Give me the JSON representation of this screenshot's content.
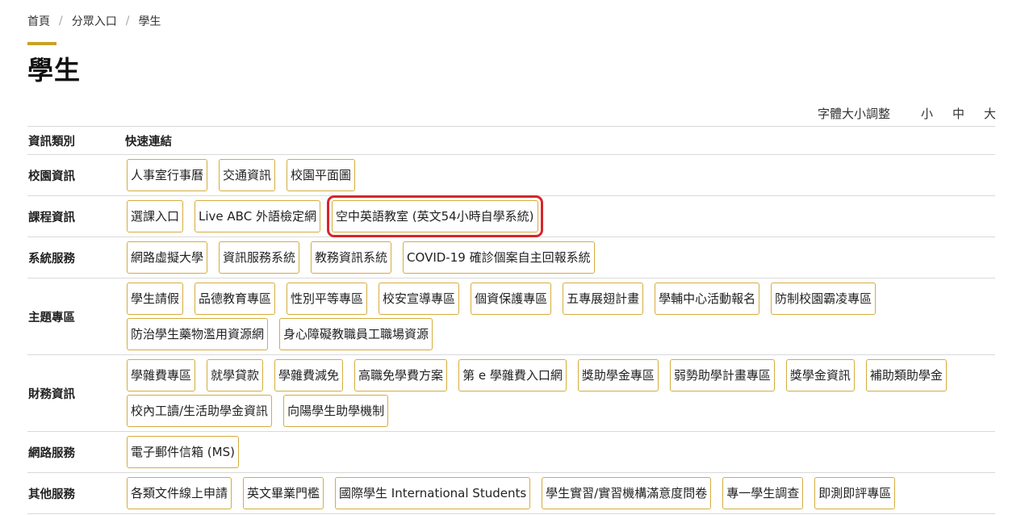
{
  "breadcrumb": [
    "首頁",
    "分眾入口",
    "學生"
  ],
  "page_title": "學生",
  "font_size": {
    "label": "字體大小調整",
    "options": [
      "小",
      "中",
      "大"
    ]
  },
  "table": {
    "header": {
      "category": "資訊類別",
      "links": "快速連結"
    },
    "rows": [
      {
        "category": "校園資訊",
        "links": [
          "人事室行事曆",
          "交通資訊",
          "校園平面圖"
        ]
      },
      {
        "category": "課程資訊",
        "links": [
          "選課入口",
          "Live ABC 外語檢定網",
          "空中英語教室 (英文54小時自學系統)"
        ]
      },
      {
        "category": "系統服務",
        "links": [
          "網路虛擬大學",
          "資訊服務系統",
          "教務資訊系統",
          "COVID-19 確診個案自主回報系統"
        ]
      },
      {
        "category": "主題專區",
        "links": [
          "學生請假",
          "品德教育專區",
          "性別平等專區",
          "校安宣導專區",
          "個資保護專區",
          "五專展翅計畫",
          "學輔中心活動報名",
          "防制校園霸凌專區",
          "防治學生藥物濫用資源網",
          "身心障礙教職員工職場資源"
        ]
      },
      {
        "category": "財務資訊",
        "links": [
          "學雜費專區",
          "就學貸款",
          "學雜費減免",
          "高職免學費方案",
          "第 e 學雜費入口網",
          "獎助學金專區",
          "弱勢助學計畫專區",
          "獎學金資訊",
          "補助類助學金",
          "校內工讀/生活助學金資訊",
          "向陽學生助學機制"
        ]
      },
      {
        "category": "網路服務",
        "links": [
          "電子郵件信箱 (MS)"
        ]
      },
      {
        "category": "其他服務",
        "links": [
          "各類文件線上申請",
          "英文畢業門檻",
          "國際學生 International Students",
          "學生實習/實習機構滿意度問卷",
          "專一學生調查",
          "即測即評專區"
        ]
      }
    ]
  },
  "highlight_color": "#d6262b",
  "accent_color": "#c9a227"
}
